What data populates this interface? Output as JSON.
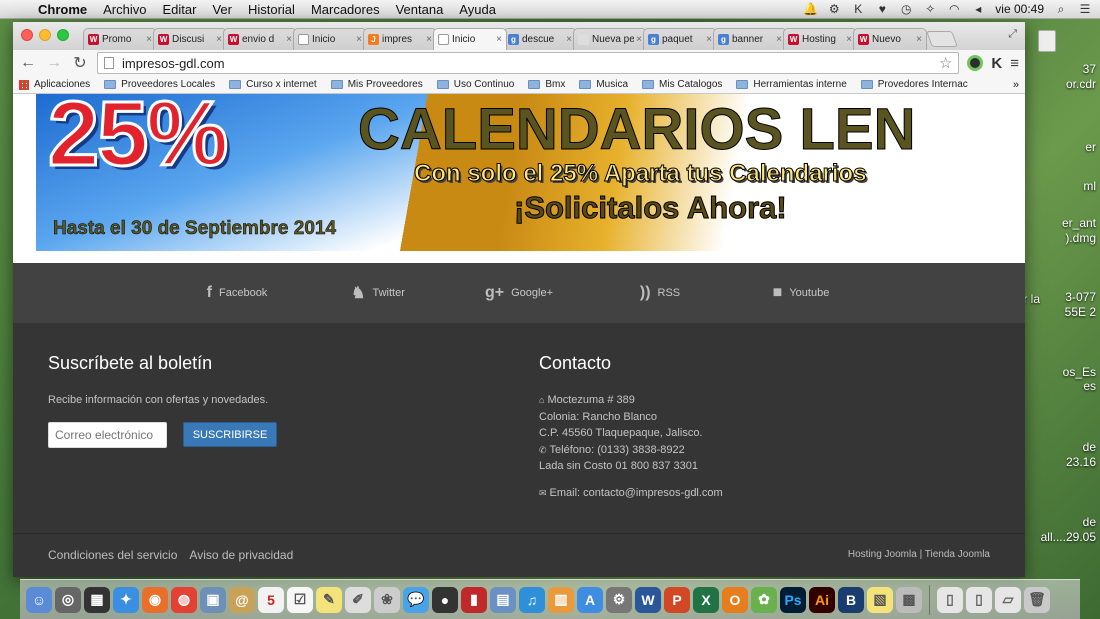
{
  "menubar": {
    "app": "Chrome",
    "items": [
      "Archivo",
      "Editar",
      "Ver",
      "Historial",
      "Marcadores",
      "Ventana",
      "Ayuda"
    ],
    "clock": "vie 00:49"
  },
  "tabs": [
    {
      "title": "Promo",
      "favicon": "W",
      "color": "#c8102e"
    },
    {
      "title": "Discusi",
      "favicon": "W",
      "color": "#c8102e"
    },
    {
      "title": "envio d",
      "favicon": "W",
      "color": "#c8102e"
    },
    {
      "title": "Inicio",
      "favicon": "page-icon",
      "color": "#cccccc"
    },
    {
      "title": "impres",
      "favicon": "J",
      "color": "#f47b20"
    },
    {
      "title": "Inicio",
      "favicon": "page-icon",
      "color": "#cccccc",
      "active": true
    },
    {
      "title": "descue",
      "favicon": "g",
      "color": "#4a7fd4"
    },
    {
      "title": "Nueva pes",
      "favicon": "",
      "color": "#dddddd"
    },
    {
      "title": "paquet",
      "favicon": "g",
      "color": "#4a7fd4"
    },
    {
      "title": "banner",
      "favicon": "g",
      "color": "#4a7fd4"
    },
    {
      "title": "Hosting",
      "favicon": "W",
      "color": "#c8102e"
    },
    {
      "title": "Nuevo",
      "favicon": "W",
      "color": "#c8102e"
    }
  ],
  "address_bar": {
    "url": "impresos-gdl.com"
  },
  "bookmarks": [
    "Aplicaciones",
    "Proveedores Locales",
    "Curso x internet",
    "Mis Proveedores",
    "Uso Continuo",
    "Bmx",
    "Musica",
    "Mis Catalogos",
    "Herramientas interne",
    "Provedores Internac"
  ],
  "banner": {
    "percent": "25%",
    "title": "CALENDARIOS LEN",
    "subtitle": "Con solo el 25% Aparta tus Calendarios",
    "cta": "¡Solicitalos Ahora!",
    "deadline": "Hasta el 30 de Septiembre 2014"
  },
  "social": [
    {
      "label": "Facebook",
      "icon": "facebook-icon",
      "glyph": "f"
    },
    {
      "label": "Twitter",
      "icon": "twitter-icon",
      "glyph": "🐦"
    },
    {
      "label": "Google+",
      "icon": "google-plus-icon",
      "glyph": "g+"
    },
    {
      "label": "RSS",
      "icon": "rss-icon",
      "glyph": "))"
    },
    {
      "label": "Youtube",
      "icon": "youtube-icon",
      "glyph": "■"
    }
  ],
  "newsletter": {
    "heading": "Suscríbete al boletín",
    "description": "Recibe información con ofertas y novedades.",
    "placeholder": "Correo electrónico",
    "button": "SUSCRIBIRSE"
  },
  "contact": {
    "heading": "Contacto",
    "address": "Moctezuma # 389",
    "colonia": "Colonia: Rancho Blanco",
    "cp": "C.P. 45560 Tlaquepaque, Jalisco.",
    "phone": "Teléfono: (0133) 3838-8922",
    "lada": "Lada sin Costo 01 800 837 3301",
    "email": "Email: contacto@impresos-gdl.com"
  },
  "footer": {
    "terms": "Condiciones del servicio",
    "privacy": "Aviso de privacidad",
    "credits": "Hosting Joomla | Tienda Joomla"
  },
  "desktop_labels": [
    "37",
    "or.cdr",
    "er",
    "ml",
    "er_ant",
    ").dmg",
    "3-077",
    "55E 2",
    "er la",
    "os_Es",
    "es",
    "de",
    "23.16",
    "de",
    "all....29.05"
  ],
  "colors": {
    "footer_bg": "#353535",
    "social_bg": "#424242",
    "button": "#3a79b8"
  }
}
